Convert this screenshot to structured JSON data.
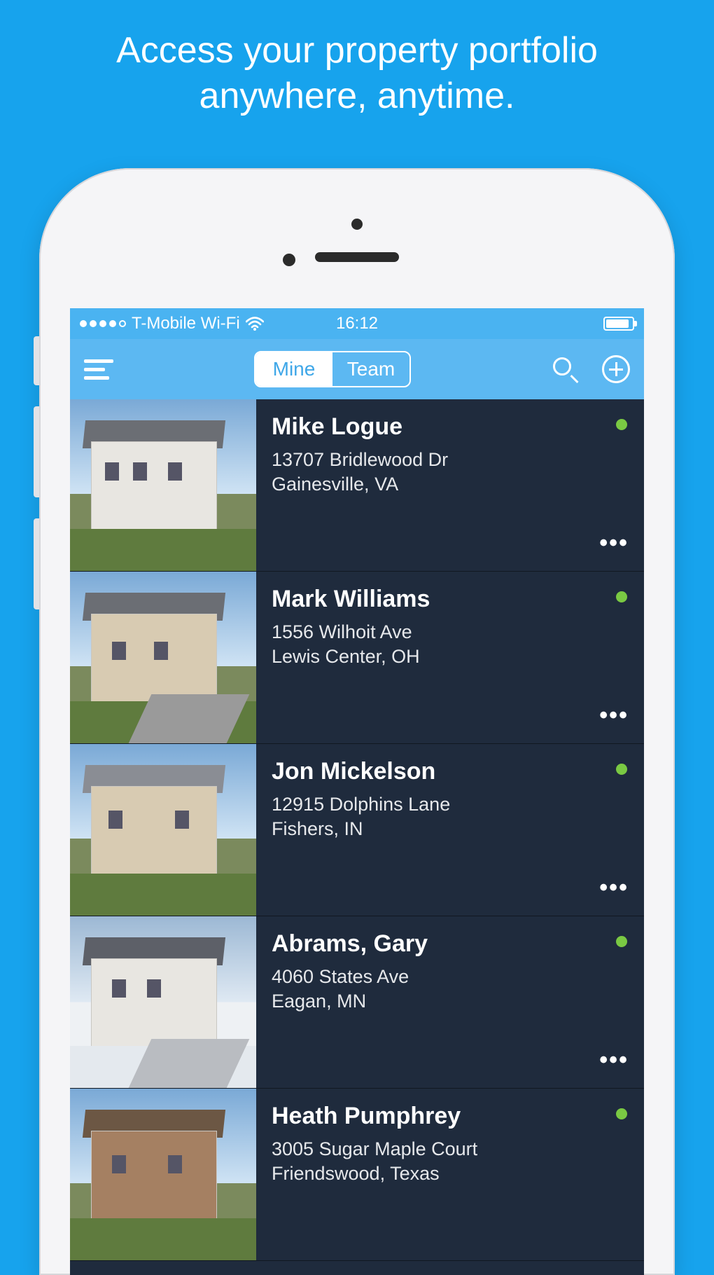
{
  "promo": {
    "line1": "Access your property portfolio",
    "line2": "anywhere, anytime."
  },
  "status_bar": {
    "carrier": "T-Mobile Wi-Fi",
    "time": "16:12"
  },
  "nav": {
    "segments": {
      "mine": "Mine",
      "team": "Team"
    }
  },
  "properties": [
    {
      "name": "Mike Logue",
      "address1": "13707 Bridlewood Dr",
      "address2": "Gainesville, VA",
      "status": "online",
      "thumb_style": ""
    },
    {
      "name": "Mark Williams",
      "address1": "1556 Wilhoit Ave",
      "address2": "Lewis Center, OH",
      "status": "online",
      "thumb_style": "tan"
    },
    {
      "name": "Jon Mickelson",
      "address1": "12915 Dolphins Lane",
      "address2": "Fishers, IN",
      "status": "online",
      "thumb_style": "tan"
    },
    {
      "name": "Abrams, Gary",
      "address1": "4060 States Ave",
      "address2": "Eagan, MN",
      "status": "online",
      "thumb_style": "snow"
    },
    {
      "name": "Heath Pumphrey",
      "address1": "3005 Sugar Maple Court",
      "address2": "Friendswood, Texas",
      "status": "online",
      "thumb_style": "brown"
    }
  ],
  "ellipsis": "•••"
}
